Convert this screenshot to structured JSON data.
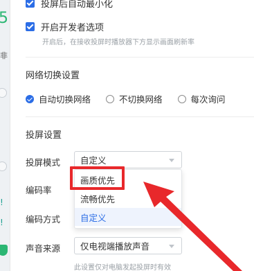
{
  "background_window": {
    "fragments": [
      "5",
      "非",
      "!",
      "!"
    ]
  },
  "options": {
    "auto_minimize": {
      "label": "投屏后自动最小化",
      "checked": true
    },
    "developer": {
      "label": "开启开发者选项",
      "checked": true,
      "hint": "开启后，在接收投屏时播放器下方显示画面刷新率"
    }
  },
  "network": {
    "title": "网络切换设置",
    "choices": [
      {
        "label": "自动切换网络",
        "selected": true
      },
      {
        "label": "不切换网络",
        "selected": false
      },
      {
        "label": "每次询问",
        "selected": false
      }
    ]
  },
  "cast": {
    "title": "投屏设置",
    "mode_label": "投屏模式",
    "mode_value": "自定义",
    "bitrate_label": "编码率",
    "encoding_label": "编码方式",
    "audio_label": "声音来源",
    "audio_value": "仅电视端播放声音",
    "audio_hint": "此设置仅对电脑发起投屏时有效",
    "dropdown_options": [
      "画质优先",
      "流畅优先",
      "自定义"
    ]
  },
  "annotation": {
    "highlight_color": "#e8282b",
    "arrow_color": "#e8282b"
  },
  "colors": {
    "accent": "#2b6de6",
    "hint": "#9aa0a6"
  }
}
